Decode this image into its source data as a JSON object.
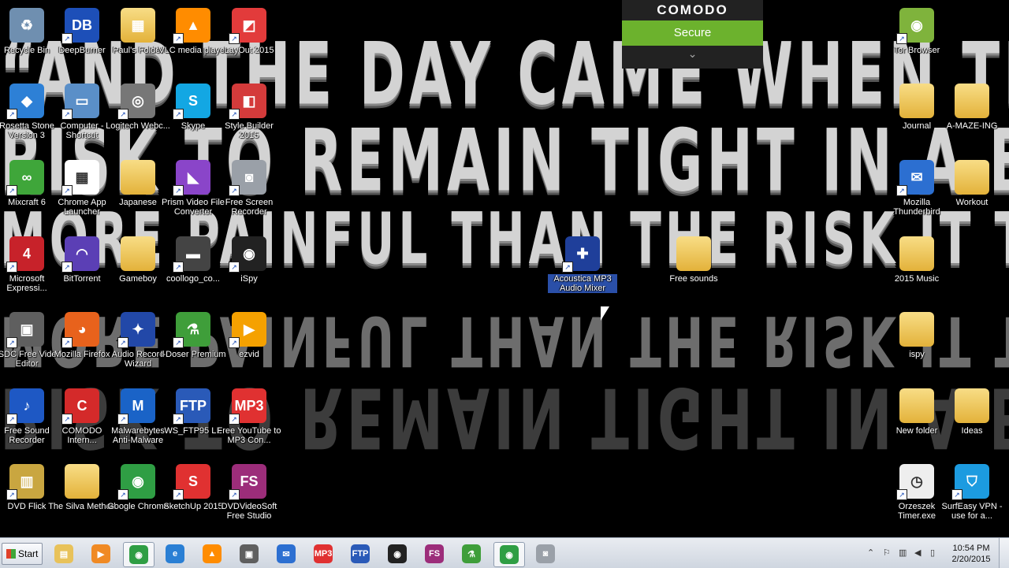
{
  "wallpaper": {
    "lines": [
      "“AND THE DAY CAME WHEN THE",
      "RISK TO REMAIN TIGHT IN A BUD WAS",
      "MORE PAINFUL THAN THE RISK IT TOOK TO BLOSSOM”"
    ]
  },
  "comodo": {
    "brand": "COMODO",
    "status": "Secure",
    "status_color": "#6cb22d"
  },
  "desktop_icons": [
    {
      "label": "Recycle Bin",
      "icon": "recycle-bin-icon",
      "color": "#6f8fb0",
      "glyph": "♻"
    },
    {
      "label": "DeepBurner",
      "icon": "deepburner-icon",
      "color": "#1d4fb8",
      "glyph": "DB"
    },
    {
      "label": "Paul's Folder",
      "icon": "chip-folder-icon",
      "color": "#2b2b2b",
      "glyph": "▦"
    },
    {
      "label": "VLC media player",
      "icon": "vlc-icon",
      "color": "#ff8c00",
      "glyph": "▲"
    },
    {
      "label": "LayOut 2015",
      "icon": "layout-icon",
      "color": "#e23b3b",
      "glyph": "◩"
    },
    {
      "label": "Tor Browser",
      "icon": "tor-browser-icon",
      "color": "#7fb33c",
      "glyph": "◉"
    },
    {
      "label": "Rosetta Stone Version 3",
      "icon": "rosetta-stone-icon",
      "color": "#2d80d6",
      "glyph": "◆"
    },
    {
      "label": "Computer - Shortcut",
      "icon": "computer-icon",
      "color": "#5a8fc8",
      "glyph": "▭"
    },
    {
      "label": "Logitech Webc...",
      "icon": "webcam-icon",
      "color": "#777777",
      "glyph": "◎"
    },
    {
      "label": "Skype",
      "icon": "skype-icon",
      "color": "#13a7e3",
      "glyph": "S"
    },
    {
      "label": "Style Builder 2015",
      "icon": "style-builder-icon",
      "color": "#d43b3b",
      "glyph": "◧"
    },
    {
      "label": "Journal",
      "icon": "folder-icon",
      "color": "#f0c65a",
      "glyph": ""
    },
    {
      "label": "A-MAZE-ING",
      "icon": "chrome-folder-icon",
      "color": "#f0c65a",
      "glyph": ""
    },
    {
      "label": "Mixcraft 6",
      "icon": "mixcraft-icon",
      "color": "#3fa63a",
      "glyph": "∞"
    },
    {
      "label": "Chrome App Launcher",
      "icon": "app-launcher-icon",
      "color": "#ffffff",
      "glyph": "▦"
    },
    {
      "label": "Japanese",
      "icon": "folder-icon",
      "color": "#f0c65a",
      "glyph": ""
    },
    {
      "label": "Prism Video File Converter",
      "icon": "prism-icon",
      "color": "#8a45c9",
      "glyph": "◣"
    },
    {
      "label": "Free Screen Recorder",
      "icon": "camera-icon",
      "color": "#9aa0a8",
      "glyph": "◙"
    },
    {
      "label": "Mozilla Thunderbird",
      "icon": "thunderbird-icon",
      "color": "#2c6fd1",
      "glyph": "✉"
    },
    {
      "label": "Workout",
      "icon": "folder-icon",
      "color": "#f0c65a",
      "glyph": ""
    },
    {
      "label": "Microsoft Expressi...",
      "icon": "ms-expression-icon",
      "color": "#c7222a",
      "glyph": "4"
    },
    {
      "label": "BitTorrent",
      "icon": "bittorrent-icon",
      "color": "#5b3fb5",
      "glyph": "◠"
    },
    {
      "label": "Gameboy",
      "icon": "folder-icon",
      "color": "#f0c65a",
      "glyph": ""
    },
    {
      "label": "coollogo_co...",
      "icon": "image-file-icon",
      "color": "#444444",
      "glyph": "▬"
    },
    {
      "label": "iSpy",
      "icon": "ispy-icon",
      "color": "#222222",
      "glyph": "◉"
    },
    {
      "label": "Acoustica MP3 Audio Mixer",
      "icon": "acoustica-icon",
      "color": "#1f3f9a",
      "glyph": "✚"
    },
    {
      "label": "Free sounds",
      "icon": "folder-icon",
      "color": "#f0c65a",
      "glyph": ""
    },
    {
      "label": "2015 Music",
      "icon": "folder-icon",
      "color": "#f0c65a",
      "glyph": ""
    },
    {
      "label": "VSDC Free Video Editor",
      "icon": "vsdc-icon",
      "color": "#5f5f5f",
      "glyph": "▣"
    },
    {
      "label": "Mozilla Firefox",
      "icon": "firefox-icon",
      "color": "#e8621c",
      "glyph": "◕"
    },
    {
      "label": "Audio Record Wizard",
      "icon": "audio-record-icon",
      "color": "#2248a8",
      "glyph": "✦"
    },
    {
      "label": "I-Doser Premium",
      "icon": "i-doser-icon",
      "color": "#3f9e3a",
      "glyph": "⚗"
    },
    {
      "label": "ezvid",
      "icon": "ezvid-icon",
      "color": "#f5a100",
      "glyph": "▶"
    },
    {
      "label": "ispy",
      "icon": "chrome-folder-icon",
      "color": "#f0c65a",
      "glyph": ""
    },
    {
      "label": "Free Sound Recorder",
      "icon": "sound-recorder-icon",
      "color": "#1e58c4",
      "glyph": "♪"
    },
    {
      "label": "COMODO Intern...",
      "icon": "comodo-icon",
      "color": "#d42a2a",
      "glyph": "C"
    },
    {
      "label": "Malwarebytes Anti-Malware",
      "icon": "malwarebytes-icon",
      "color": "#1a63c7",
      "glyph": "M"
    },
    {
      "label": "WS_FTP95 LE",
      "icon": "ftp-icon",
      "color": "#2a5ab8",
      "glyph": "FTP"
    },
    {
      "label": "Free YouTube to MP3 Con...",
      "icon": "youtube-mp3-icon",
      "color": "#e03131",
      "glyph": "MP3"
    },
    {
      "label": "New folder",
      "icon": "folder-icon",
      "color": "#f0c65a",
      "glyph": ""
    },
    {
      "label": "Ideas",
      "icon": "folder-icon",
      "color": "#f0c65a",
      "glyph": ""
    },
    {
      "label": "DVD Flick",
      "icon": "dvd-flick-icon",
      "color": "#c9a640",
      "glyph": "▥"
    },
    {
      "label": "The Silva Method",
      "icon": "silva-folder-icon",
      "color": "#c88a2a",
      "glyph": ""
    },
    {
      "label": "Google Chrome",
      "icon": "chrome-icon",
      "color": "#2f9e44",
      "glyph": "◉"
    },
    {
      "label": "SketchUp 2015",
      "icon": "sketchup-icon",
      "color": "#e03131",
      "glyph": "S"
    },
    {
      "label": "DVDVideoSoft Free Studio",
      "icon": "dvdvideosoft-icon",
      "color": "#9c2d7a",
      "glyph": "FS"
    },
    {
      "label": "Orzeszek Timer.exe",
      "icon": "clock-icon",
      "color": "#eeeeee",
      "glyph": "◷"
    },
    {
      "label": "SurfEasy VPN - use for a...",
      "icon": "surfeasy-icon",
      "color": "#1c9be0",
      "glyph": "⛉"
    }
  ],
  "taskbar": {
    "start_label": "Start",
    "pinned": [
      {
        "icon": "explorer-icon",
        "color": "#e8c25a",
        "glyph": "▤"
      },
      {
        "icon": "media-player-icon",
        "color": "#f08a24",
        "glyph": "▶"
      },
      {
        "icon": "chrome-icon",
        "color": "#2f9e44",
        "glyph": "◉"
      },
      {
        "icon": "ie-icon",
        "color": "#2a7fd4",
        "glyph": "e"
      },
      {
        "icon": "vlc-icon",
        "color": "#ff8c00",
        "glyph": "▲"
      },
      {
        "icon": "vsdc-icon",
        "color": "#5f5f5f",
        "glyph": "▣"
      },
      {
        "icon": "thunderbird-icon",
        "color": "#2c6fd1",
        "glyph": "✉"
      },
      {
        "icon": "youtube-mp3-icon",
        "color": "#e03131",
        "glyph": "MP3"
      },
      {
        "icon": "ftp-icon",
        "color": "#2a5ab8",
        "glyph": "FTP"
      },
      {
        "icon": "ispy-icon",
        "color": "#222222",
        "glyph": "◉"
      },
      {
        "icon": "dvdvideosoft-icon",
        "color": "#9c2d7a",
        "glyph": "FS"
      },
      {
        "icon": "i-doser-icon",
        "color": "#3f9e3a",
        "glyph": "⚗"
      },
      {
        "icon": "chrome-icon",
        "color": "#2f9e44",
        "glyph": "◉"
      },
      {
        "icon": "camera-icon",
        "color": "#9aa0a8",
        "glyph": "◙"
      }
    ],
    "clock_time": "10:54 PM",
    "clock_date": "2/20/2015"
  }
}
